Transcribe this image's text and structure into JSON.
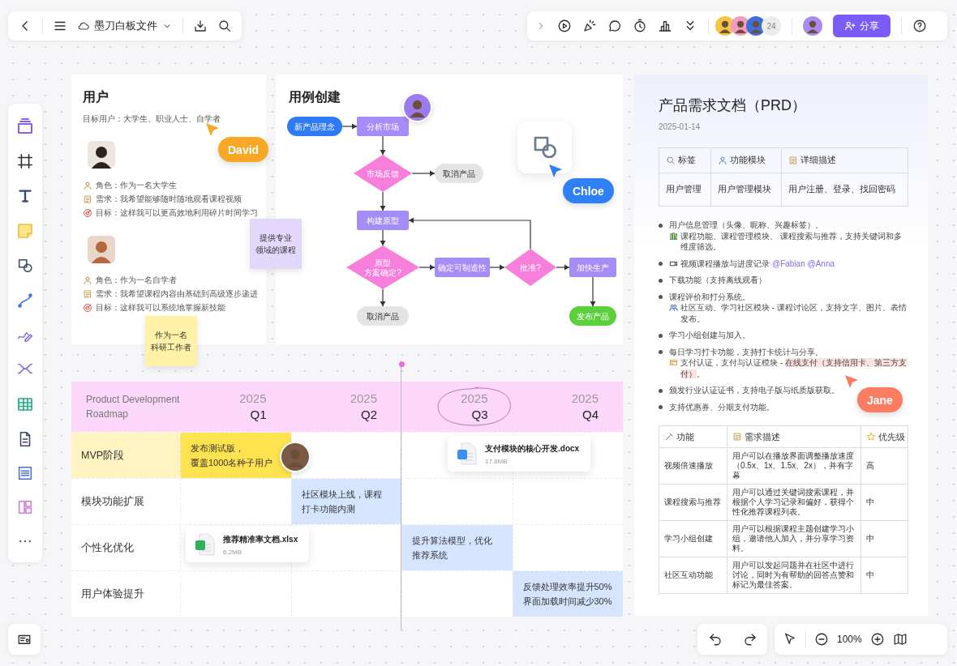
{
  "toolbar": {
    "file_name": "墨刀白板文件",
    "collaborator_count": "24",
    "share_label": "分享",
    "zoom": "100%"
  },
  "user_card": {
    "title": "用户",
    "target": "目标用户：大学生、职业人士、自学者",
    "personas": [
      {
        "lines": [
          {
            "kind": "role",
            "text": "角色：作为一名大学生"
          },
          {
            "kind": "need",
            "text": "需求：我希望能够随时随地观看课程视频"
          },
          {
            "kind": "goal",
            "text": "目标：这样我可以更高效地利用碎片时间学习"
          }
        ]
      },
      {
        "lines": [
          {
            "kind": "role",
            "text": "角色：作为一名自学者"
          },
          {
            "kind": "need",
            "text": "需求：我希望课程内容由基础到高级逐步递进"
          },
          {
            "kind": "goal",
            "text": "目标：这样我可以系统地掌握新技能"
          }
        ]
      }
    ]
  },
  "stickies": [
    {
      "lines": [
        "提供专业",
        "领域的课程"
      ],
      "color": "#e4d7fc"
    },
    {
      "lines": [
        "作为一名",
        "科研工作者"
      ],
      "color": "#fff1a8"
    }
  ],
  "flowchart": {
    "title": "用例创建",
    "nodes": [
      {
        "kind": "start",
        "text": "新产品理念"
      },
      {
        "kind": "process",
        "text": "分析市场"
      },
      {
        "kind": "decision",
        "text": "市场反馈"
      },
      {
        "kind": "cancel",
        "text": "取消产品"
      },
      {
        "kind": "process",
        "text": "构建原型"
      },
      {
        "kind": "decision",
        "lines": [
          "原型",
          "方案确定?"
        ]
      },
      {
        "kind": "process",
        "text": "确定可制造性"
      },
      {
        "kind": "decision",
        "text": "批准?"
      },
      {
        "kind": "process",
        "text": "加快生产"
      },
      {
        "kind": "cancel",
        "text": "取消产品"
      },
      {
        "kind": "finish",
        "text": "发布产品"
      }
    ]
  },
  "cursors": [
    {
      "name": "David",
      "color": "#f8a824"
    },
    {
      "name": "Chloe",
      "color": "#2f80f6"
    },
    {
      "name": "Jane",
      "color": "#fa7d62"
    }
  ],
  "prd": {
    "title": "产品需求文档（PRD）",
    "date": "2025-01-14",
    "table1": {
      "headers": [
        "标签",
        "功能模块",
        "详细描述"
      ],
      "rows": [
        [
          "用户管理",
          "用户管理模块",
          "用户注册、登录、找回密码"
        ]
      ]
    },
    "bullets": [
      {
        "text": "用户信息管理（头像、昵称、兴趣标签）。",
        "sub": [
          {
            "text": "课程功能、课程管理模块、 课程搜索与推荐，支持关键词和多维度筛选。",
            "highlighted": false
          }
        ]
      },
      {
        "text": "视频课程播放与进度记录",
        "mention": "@Fabian @Anna"
      },
      {
        "text": "下载功能（支持离线观看）"
      },
      {
        "text": "课程评价和打分系统。",
        "sub": [
          {
            "text": "社区互动、学习社区模块 - 课程讨论区，支持文字、图片、表情发布。",
            "highlighted": false
          }
        ]
      },
      {
        "text": "学习小组创建与加入。"
      },
      {
        "text": "每日学习打卡功能，支持打卡统计与分享。",
        "sub": [
          {
            "text": "支付认证，支付与认证模块 - ",
            "highlighted": false
          },
          {
            "text": "在线支付（支持信用卡、第三方支付）",
            "highlighted": true
          },
          {
            "text": "。",
            "highlighted": false
          }
        ]
      },
      {
        "text": "颁发行业认证证书，支持电子版与纸质版获取。"
      },
      {
        "text": "支持优惠券、分期支付功能。"
      }
    ],
    "table2": {
      "headers": [
        "功能",
        "需求描述",
        "优先级"
      ],
      "rows": [
        [
          "视频倍速播放",
          "用户可以在播放界面调整播放速度（0.5x、1x、1.5x、2x），并有字幕",
          "高"
        ],
        [
          "课程搜索与推荐",
          "用户可以通过关键词搜索课程，并根据个人学习记录和偏好，获得个性化推荐课程列表。",
          "中"
        ],
        [
          "学习小组创建",
          "用户可以根据课程主题创建学习小组，邀请他人加入，并分享学习资料。",
          "中"
        ],
        [
          "社区互动功能",
          "用户可以发起问题并在社区中进行讨论，同时为有帮助的回答点赞和标记为最佳答案。",
          "中"
        ]
      ]
    }
  },
  "roadmap": {
    "title": "Product Development Roadmap",
    "quarters": [
      {
        "year": "2025",
        "quarter": "Q1",
        "circled": false
      },
      {
        "year": "2025",
        "quarter": "Q2",
        "circled": false
      },
      {
        "year": "2025",
        "quarter": "Q3",
        "circled": true
      },
      {
        "year": "2025",
        "quarter": "Q4",
        "circled": false
      }
    ],
    "rows": [
      {
        "label": "MVP阶段",
        "highlighted": true,
        "cells": [
          {
            "filled": true,
            "lines": [
              "发布测试版，",
              "覆盖1000名种子用户"
            ],
            "color": "#ffe24f"
          },
          {
            "filled": false
          },
          {
            "filled": false
          },
          {
            "filled": false
          }
        ]
      },
      {
        "label": "模块功能扩展",
        "highlighted": false,
        "cells": [
          {
            "filled": false
          },
          {
            "filled": true,
            "lines": [
              "社区模块上线，课程",
              "打卡功能内测"
            ],
            "color": "#d5e5ff"
          },
          {
            "filled": false
          },
          {
            "filled": false
          }
        ]
      },
      {
        "label": "个性化优化",
        "highlighted": false,
        "cells": [
          {
            "filled": false
          },
          {
            "filled": false
          },
          {
            "filled": true,
            "lines": [
              "提升算法模型，优化",
              "推荐系统"
            ],
            "color": "#d5e5ff"
          },
          {
            "filled": false
          }
        ]
      },
      {
        "label": "用户体验提升",
        "highlighted": false,
        "cells": [
          {
            "filled": false
          },
          {
            "filled": false
          },
          {
            "filled": false
          },
          {
            "filled": true,
            "lines": [
              "反馈处理效率提升50%",
              "界面加载时间减少30%"
            ],
            "color": "#d5e5ff"
          }
        ]
      }
    ]
  },
  "files": [
    {
      "kind": "docx",
      "name": "支付模块的核心开发.docx",
      "size": "17.8MB"
    },
    {
      "kind": "xlsx",
      "name": "推荐精准率文档.xlsx",
      "size": "6.2MB"
    }
  ]
}
